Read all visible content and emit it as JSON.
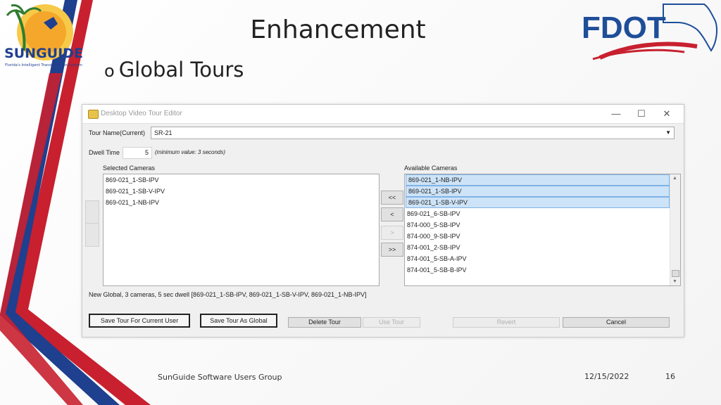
{
  "slide": {
    "title": "Enhancement",
    "bullet": "Global Tours",
    "bullet_marker": "o",
    "footer_text": "SunGuide Software Users Group",
    "date": "12/15/2022",
    "page_number": "16",
    "logos": {
      "left": {
        "text": "SUNGUIDE",
        "subtitle": "Florida's Intelligent Transportation System"
      },
      "right": {
        "text": "FDOT"
      }
    }
  },
  "window": {
    "title": "Desktop Video Tour Editor",
    "controls": {
      "minimize": "—",
      "maximize": "☐",
      "close": "✕"
    },
    "tour_name_label": "Tour Name(Current)",
    "tour_name_value": "SR-21",
    "dwell_label": "Dwell Time",
    "dwell_value": "5",
    "dwell_note": "(minimum value: 3 seconds)",
    "selected_label": "Selected Cameras",
    "available_label": "Available Cameras",
    "selected_cameras": [
      "869-021_1-SB-IPV",
      "869-021_1-SB-V-IPV",
      "869-021_1-NB-IPV"
    ],
    "available_cameras": [
      {
        "name": "869-021_1-NB-IPV",
        "selected": true
      },
      {
        "name": "869-021_1-SB-IPV",
        "selected": true
      },
      {
        "name": "869-021_1-SB-V-IPV",
        "selected": true
      },
      {
        "name": "869-021_6-SB-IPV",
        "selected": false
      },
      {
        "name": "874-000_5-SB-IPV",
        "selected": false
      },
      {
        "name": "874-000_9-SB-IPV",
        "selected": false
      },
      {
        "name": "874-001_2-SB-IPV",
        "selected": false
      },
      {
        "name": "874-001_5-SB-A-IPV",
        "selected": false
      },
      {
        "name": "874-001_5-SB-B-IPV",
        "selected": false
      }
    ],
    "move_buttons": {
      "all_left": "<<",
      "left": "<",
      "right": ">",
      "all_right": ">>"
    },
    "side_buttons": {
      "up": "^",
      "down": "v"
    },
    "status": "New Global, 3 cameras, 5 sec dwell [869-021_1-SB-IPV, 869-021_1-SB-V-IPV, 869-021_1-NB-IPV]",
    "buttons": {
      "save_user": "Save Tour For Current User",
      "save_global": "Save Tour As Global",
      "delete": "Delete Tour",
      "use": "Use Tour",
      "revert": "Revert",
      "cancel": "Cancel"
    }
  },
  "colors": {
    "red": "#c8202f",
    "blue": "#1f3f8f",
    "fdot_blue": "#1f4e99",
    "selection": "#cde3f7"
  }
}
